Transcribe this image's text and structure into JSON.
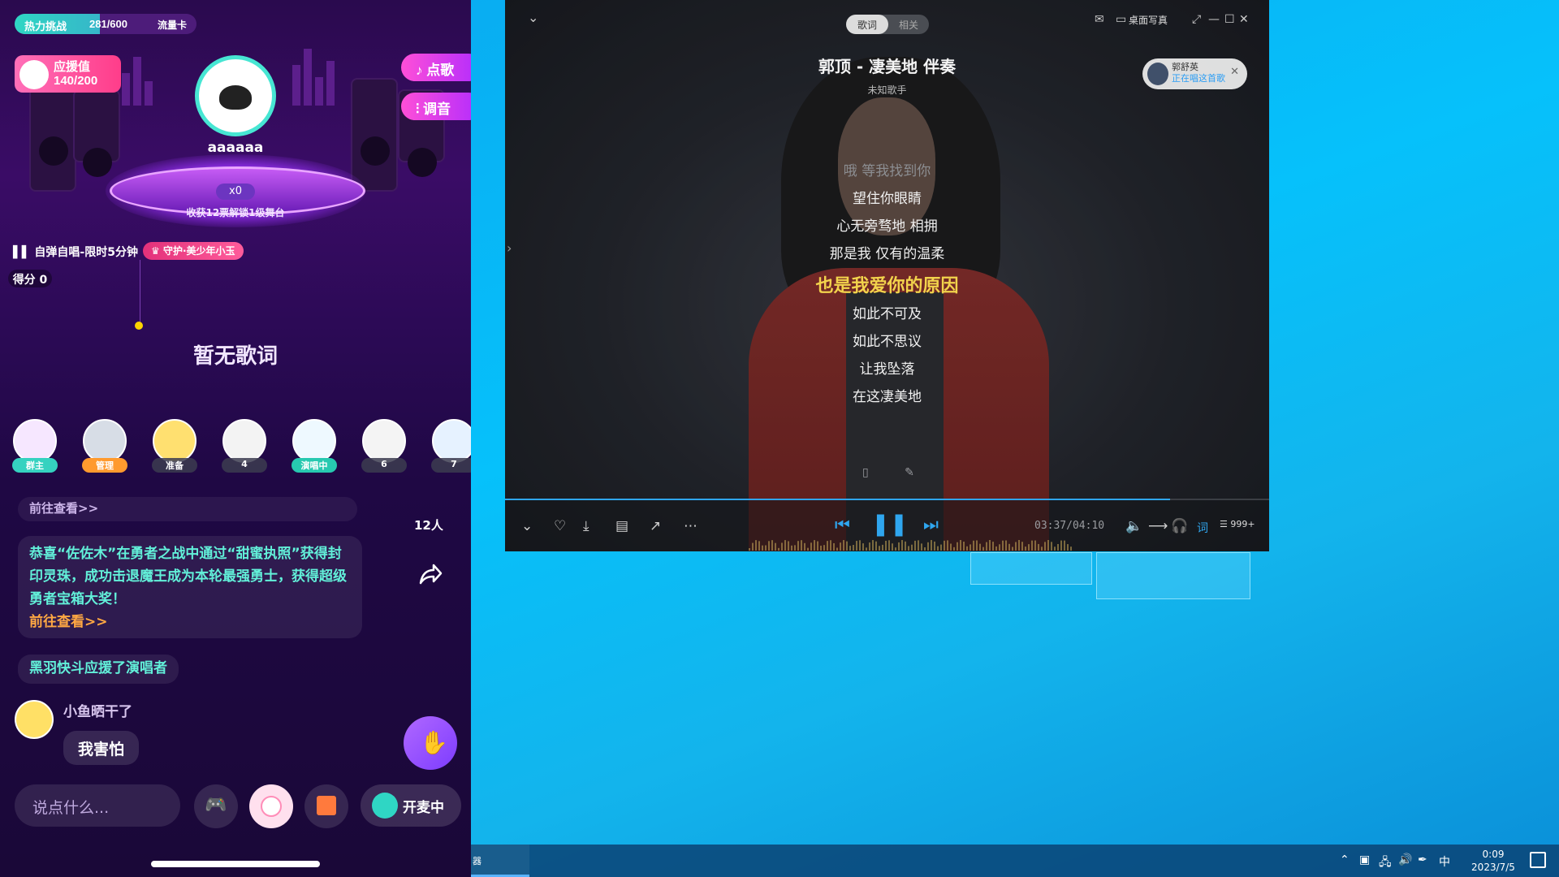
{
  "phone": {
    "challenge": {
      "label": "热力挑战",
      "progress_text": "281/600",
      "progress_fraction": 0.468,
      "card_label": "流量卡"
    },
    "cheer": {
      "label": "应援值",
      "value": "140/200"
    },
    "buttons": {
      "request_song": "点歌",
      "tune": "调音"
    },
    "host": {
      "name": "aaaaaa",
      "coin": "x0",
      "reward_text": "收获12票解锁1级舞台"
    },
    "mode_text": "自弹自唱-限时5分钟",
    "guard_text": "守护·美少年小玉",
    "score_text": "得分 0",
    "no_lyrics": "暂无歌词",
    "seats": [
      {
        "tag": "群主",
        "style": "host"
      },
      {
        "tag": "管理",
        "style": "manage"
      },
      {
        "tag": "准备",
        "style": ""
      },
      {
        "tag": "4",
        "style": ""
      },
      {
        "tag": "演唱中",
        "style": "sing"
      },
      {
        "tag": "6",
        "style": ""
      },
      {
        "tag": "7",
        "style": ""
      }
    ],
    "audience_count": "12人",
    "msg_top": "前往查看>>",
    "announcement": {
      "text": "恭喜“佐佐木”在勇者之战中通过“甜蜜执照”获得封印灵珠，成功击退魔王成为本轮最强勇士，获得超级勇者宝箱大奖！",
      "link": "前往查看>>"
    },
    "cheered_msg": "黑羽快斗应援了演唱者",
    "chat": {
      "user": "小鱼晒干了",
      "message": "我害怕"
    },
    "input_placeholder": "说点什么...",
    "mic_label": "开麦中"
  },
  "player": {
    "tabs": [
      "歌词",
      "相关"
    ],
    "desktop_portrait": "桌面写真",
    "song_title": "郭顶 - 凄美地  伴奏",
    "artist": "未知歌手",
    "singer_card": {
      "name": "郭舒英",
      "status": "正在唱这首歌"
    },
    "lyrics": [
      {
        "text": "哦 等我找到你",
        "state": "dim"
      },
      {
        "text": "望住你眼睛",
        "state": ""
      },
      {
        "text": "心无旁骛地 相拥",
        "state": ""
      },
      {
        "text": "那是我 仅有的温柔",
        "state": ""
      },
      {
        "text": "也是我爱你的原因",
        "state": "current"
      },
      {
        "text": "如此不可及",
        "state": ""
      },
      {
        "text": "如此不思议",
        "state": ""
      },
      {
        "text": "让我坠落",
        "state": ""
      },
      {
        "text": "在这凄美地",
        "state": ""
      }
    ],
    "time": "03:37/04:10",
    "progress_fraction": 0.87,
    "lyric_toggle": "词",
    "playlist_count": "999+"
  },
  "taskbar": {
    "app_label": "器",
    "ime": "中",
    "time": "0:09",
    "date": "2023/7/5"
  }
}
